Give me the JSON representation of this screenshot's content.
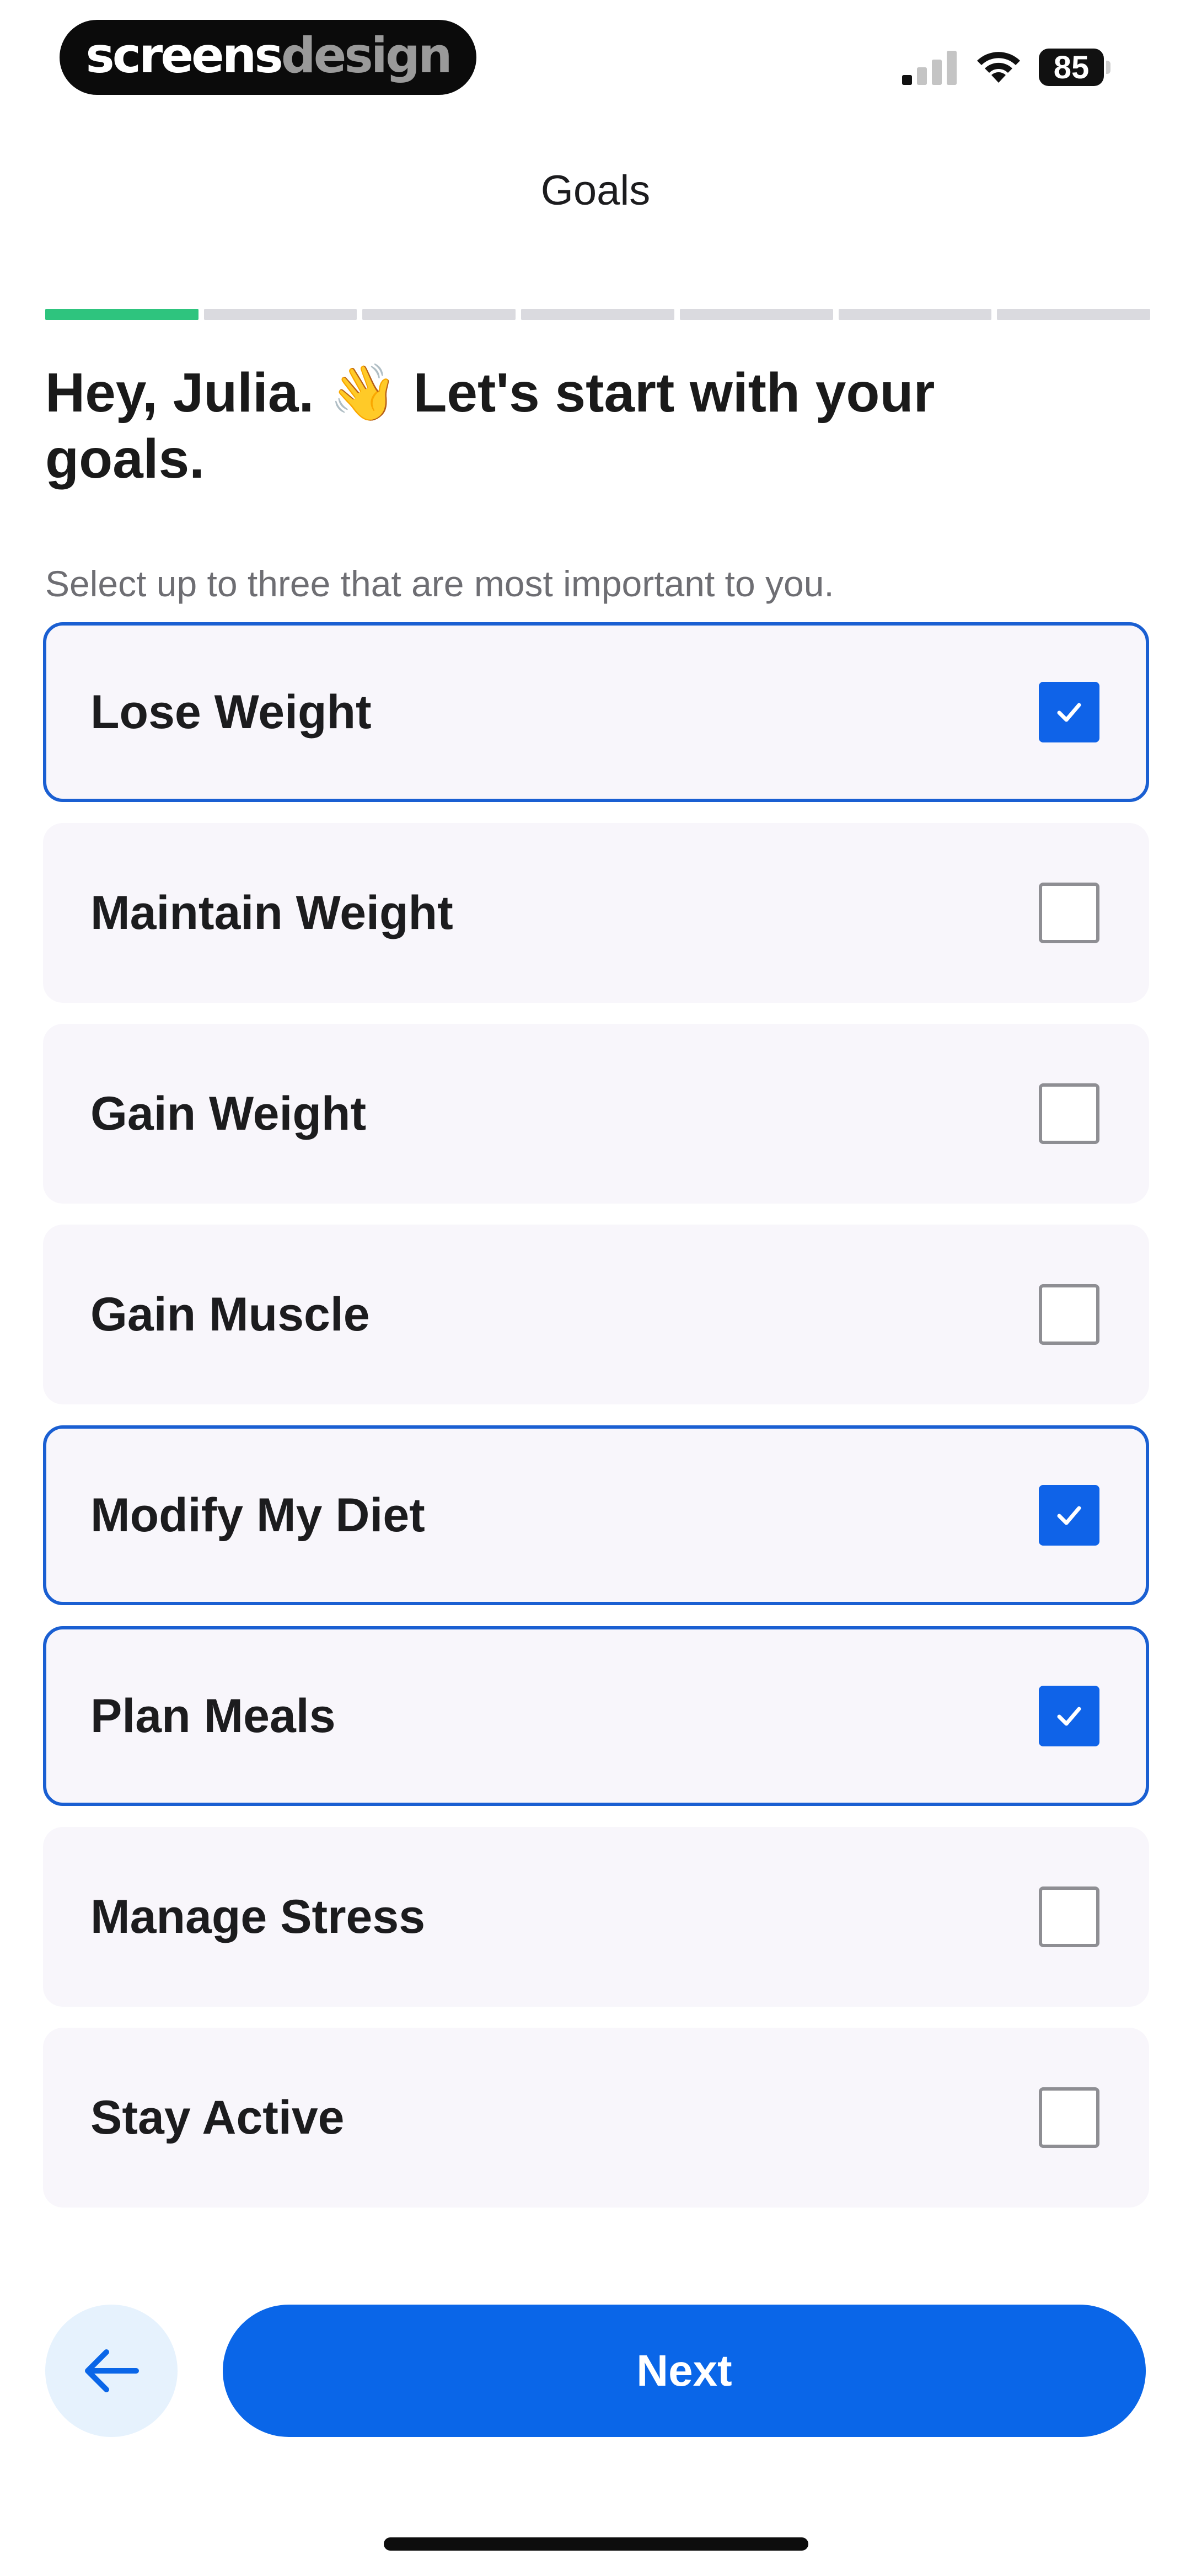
{
  "status_bar": {
    "brand_primary": "screens",
    "brand_secondary": "design",
    "battery_level": "85",
    "signal_icon": "cellular-signal-icon",
    "wifi_icon": "wifi-icon"
  },
  "nav": {
    "title": "Goals"
  },
  "progress": {
    "total_steps": 7,
    "completed_steps": 1
  },
  "header": {
    "heading": "Hey, Julia. 👋 Let's start with your goals.",
    "subheading": "Select up to three that are most important to you."
  },
  "goals": [
    {
      "label": "Lose Weight",
      "selected": true
    },
    {
      "label": "Maintain Weight",
      "selected": false
    },
    {
      "label": "Gain Weight",
      "selected": false
    },
    {
      "label": "Gain Muscle",
      "selected": false
    },
    {
      "label": "Modify My Diet",
      "selected": true
    },
    {
      "label": "Plan Meals",
      "selected": true
    },
    {
      "label": "Manage Stress",
      "selected": false
    },
    {
      "label": "Stay Active",
      "selected": false
    }
  ],
  "actions": {
    "back_icon": "arrow-left-icon",
    "next_label": "Next"
  },
  "colors": {
    "accent": "#0a66e8",
    "selected_border": "#1a5fd2",
    "progress_done": "#2ec47e",
    "progress_todo": "#dadadf",
    "card_background": "#f8f6fb",
    "back_button_background": "#e6f2fd"
  }
}
